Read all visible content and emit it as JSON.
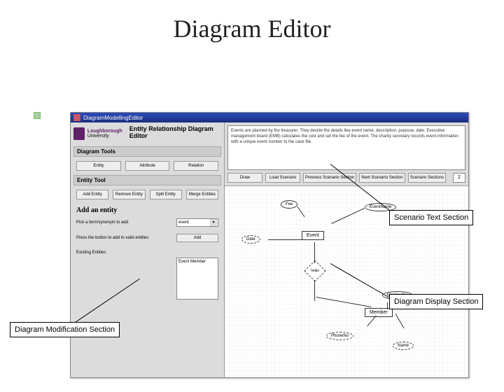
{
  "slide_title": "Diagram Editor",
  "titlebar": "DiagramModellingEditor",
  "logo": {
    "org": "Loughborough",
    "sub": "University"
  },
  "header_title": "Entity Relationship Diagram Editor",
  "panels": {
    "tools_head": "Diagram Tools",
    "tool_buttons": [
      "Entity",
      "Attribute",
      "Relation"
    ],
    "entity_tool_head": "Entity Tool",
    "entity_buttons": [
      "Add Entity",
      "Remove Entity",
      "Split Entity",
      "Merge Entities"
    ],
    "add_entity_head": "Add an entity",
    "pick_syn_label": "Pick a term/synonym to add",
    "pick_syn_value": "event",
    "add_hint": "Press the button to add to valid entities",
    "add_btn": "Add",
    "existing_label": "Existing Entities",
    "existing_value": "Event Member"
  },
  "scenario": {
    "text": "Events are planned by the treasurer. They decide the details like event name, description, purpose, date. Executive management board (EMB) calculates the cost and set the fee of the event. The charity secretary records event information with a unique event number to the case file.",
    "buttons": [
      "Draw",
      "Load Scenario",
      "Previous Scenario Section",
      "Next Scenario Section",
      "Scenario Sections"
    ],
    "page": "2"
  },
  "diagram": {
    "entities": [
      "Event",
      "Member"
    ],
    "attrs": [
      "Fee",
      "EventName",
      "Date",
      "MemberNo",
      "PhoneNo",
      "Name"
    ],
    "rel": "helps"
  },
  "callouts": {
    "scenario": "Scenario Text Section",
    "display": "Diagram Display Section",
    "modification": "Diagram Modification Section"
  }
}
